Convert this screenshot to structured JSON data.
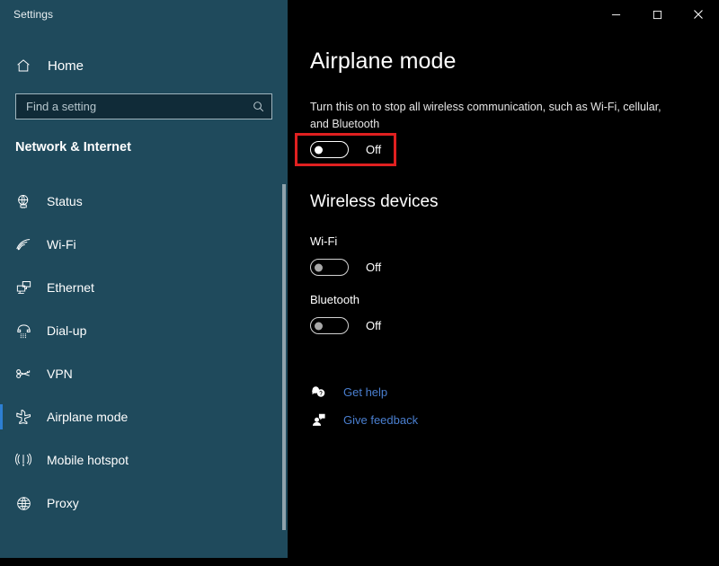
{
  "window": {
    "app_title": "Settings",
    "controls": [
      {
        "name": "minimize-button",
        "glyph": "minimize"
      },
      {
        "name": "maximize-button",
        "glyph": "maximize"
      },
      {
        "name": "close-button",
        "glyph": "close"
      }
    ]
  },
  "sidebar": {
    "home_label": "Home",
    "home_icon": "home-icon",
    "search": {
      "placeholder": "Find a setting",
      "value": "",
      "icon": "search-icon"
    },
    "section_title": "Network & Internet",
    "items": [
      {
        "label": "Status",
        "icon": "status-globe-icon",
        "selected": false
      },
      {
        "label": "Wi-Fi",
        "icon": "wifi-icon",
        "selected": false
      },
      {
        "label": "Ethernet",
        "icon": "ethernet-icon",
        "selected": false
      },
      {
        "label": "Dial-up",
        "icon": "dialup-phone-icon",
        "selected": false
      },
      {
        "label": "VPN",
        "icon": "vpn-key-icon",
        "selected": false
      },
      {
        "label": "Airplane mode",
        "icon": "airplane-icon",
        "selected": true
      },
      {
        "label": "Mobile hotspot",
        "icon": "hotspot-broadcast-icon",
        "selected": false
      },
      {
        "label": "Proxy",
        "icon": "globe-icon",
        "selected": false
      }
    ]
  },
  "main": {
    "heading": "Airplane mode",
    "description": "Turn this on to stop all wireless communication, such as Wi-Fi, cellular, and Bluetooth",
    "airplane_toggle": {
      "state_label": "Off",
      "on": false,
      "highlighted": true
    },
    "wireless_heading": "Wireless devices",
    "devices": [
      {
        "label": "Wi-Fi",
        "state_label": "Off",
        "on": false
      },
      {
        "label": "Bluetooth",
        "state_label": "Off",
        "on": false
      }
    ],
    "links": [
      {
        "label": "Get help",
        "icon": "help-bubble-icon"
      },
      {
        "label": "Give feedback",
        "icon": "feedback-person-icon"
      }
    ]
  },
  "colors": {
    "sidebar_bg": "#1f4a5c",
    "main_bg": "#000000",
    "accent_selection": "#2d7fd3",
    "link": "#4a7fd0",
    "highlight_box": "#e02020"
  }
}
